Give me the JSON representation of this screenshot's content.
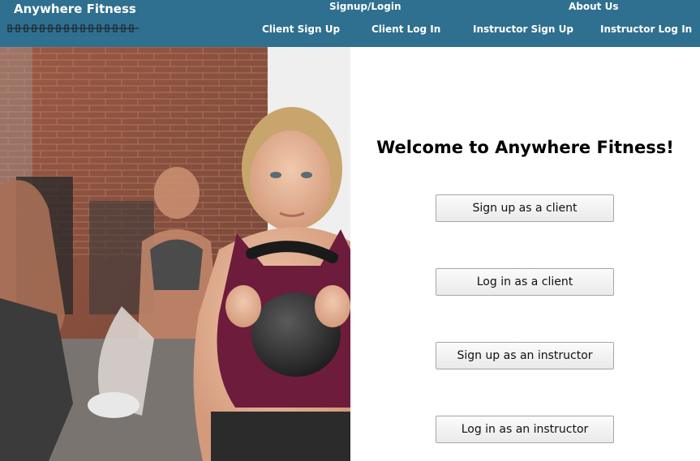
{
  "header": {
    "brand": "Anywhere Fitness",
    "brand_mark_icon": "dumbbell-chain-icon",
    "nav": {
      "signup_login": "Signup/Login",
      "about_us": "About Us",
      "client_sign_up": "Client Sign Up",
      "client_log_in": "Client Log In",
      "instructor_sign_up": "Instructor Sign Up",
      "instructor_log_in": "Instructor Log In"
    }
  },
  "hero": {
    "image_subject": "fitness-class-kettlebell-photo"
  },
  "main": {
    "welcome": "Welcome to Anywhere Fitness!",
    "buttons": {
      "client_signup": "Sign up as a client",
      "client_login": "Log in as a client",
      "instructor_signup": "Sign up as an instructor",
      "instructor_login": "Log in as an instructor"
    }
  },
  "colors": {
    "nav_bg": "#2f6f8f",
    "nav_text": "#ffffff",
    "button_border": "#a6a6a6"
  }
}
